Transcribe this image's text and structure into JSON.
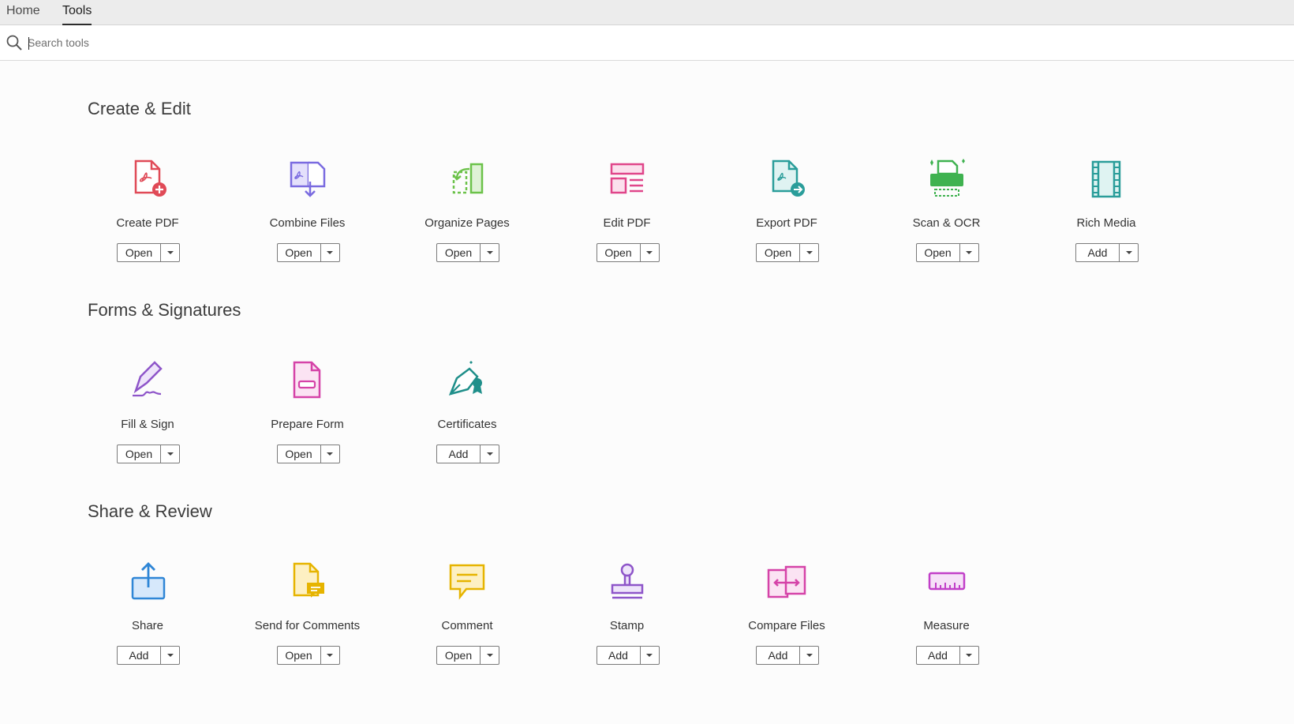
{
  "tabs": [
    {
      "label": "Home"
    },
    {
      "label": "Tools"
    }
  ],
  "search": {
    "placeholder": "Search tools",
    "value": ""
  },
  "sections": [
    {
      "title": "Create & Edit",
      "tools": [
        {
          "name": "Create PDF",
          "button": "Open",
          "icon": "create-pdf-icon",
          "color": "#e04a57"
        },
        {
          "name": "Combine Files",
          "button": "Open",
          "icon": "combine-files-icon",
          "color": "#7a6be0"
        },
        {
          "name": "Organize Pages",
          "button": "Open",
          "icon": "organize-pages-icon",
          "color": "#6cc24a"
        },
        {
          "name": "Edit PDF",
          "button": "Open",
          "icon": "edit-pdf-icon",
          "color": "#e0468a"
        },
        {
          "name": "Export PDF",
          "button": "Open",
          "icon": "export-pdf-icon",
          "color": "#2a9d9a"
        },
        {
          "name": "Scan & OCR",
          "button": "Open",
          "icon": "scan-ocr-icon",
          "color": "#3fb250"
        },
        {
          "name": "Rich Media",
          "button": "Add",
          "icon": "rich-media-icon",
          "color": "#2a9d9a"
        }
      ]
    },
    {
      "title": "Forms & Signatures",
      "tools": [
        {
          "name": "Fill & Sign",
          "button": "Open",
          "icon": "fill-sign-icon",
          "color": "#8e55c9"
        },
        {
          "name": "Prepare Form",
          "button": "Open",
          "icon": "prepare-form-icon",
          "color": "#d543a8"
        },
        {
          "name": "Certificates",
          "button": "Add",
          "icon": "certificates-icon",
          "color": "#1f8f8a"
        }
      ]
    },
    {
      "title": "Share & Review",
      "tools": [
        {
          "name": "Share",
          "button": "Add",
          "icon": "share-icon",
          "color": "#2f86d6"
        },
        {
          "name": "Send for Comments",
          "button": "Open",
          "icon": "send-for-comments-icon",
          "color": "#e6b400"
        },
        {
          "name": "Comment",
          "button": "Open",
          "icon": "comment-icon",
          "color": "#e6b400"
        },
        {
          "name": "Stamp",
          "button": "Add",
          "icon": "stamp-icon",
          "color": "#8e55c9"
        },
        {
          "name": "Compare Files",
          "button": "Add",
          "icon": "compare-files-icon",
          "color": "#d543a8"
        },
        {
          "name": "Measure",
          "button": "Add",
          "icon": "measure-icon",
          "color": "#c13fc8"
        }
      ]
    }
  ]
}
